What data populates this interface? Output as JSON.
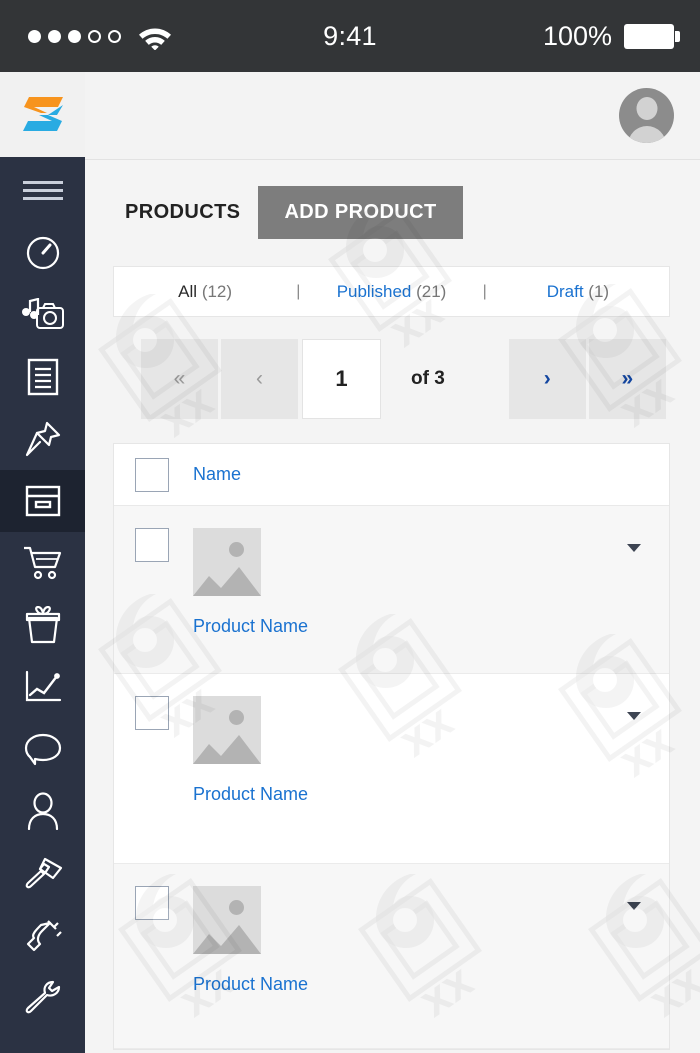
{
  "status_bar": {
    "signal_dots_filled": 3,
    "signal_dots_empty": 2,
    "wifi_icon": "wifi-icon",
    "time": "9:41",
    "battery_percent": "100%",
    "battery_icon": "battery-full-icon"
  },
  "header": {
    "logo_icon": "brand-logo-icon",
    "logo_colors": {
      "orange": "#F7941E",
      "blue": "#29ABE2"
    },
    "avatar_icon": "user-avatar-icon"
  },
  "sidebar": {
    "background": "#2b3243",
    "active_background": "#1d2330",
    "items": [
      {
        "icon": "hamburger-menu-icon",
        "label": "Menu",
        "active": false
      },
      {
        "icon": "dashboard-gauge-icon",
        "label": "Dashboard",
        "active": false
      },
      {
        "icon": "media-camera-music-icon",
        "label": "Media",
        "active": false
      },
      {
        "icon": "document-list-icon",
        "label": "Pages",
        "active": false
      },
      {
        "icon": "pushpin-icon",
        "label": "Posts",
        "active": false
      },
      {
        "icon": "archive-box-icon",
        "label": "Products",
        "active": true
      },
      {
        "icon": "shopping-cart-icon",
        "label": "Orders",
        "active": false
      },
      {
        "icon": "gift-box-icon",
        "label": "Coupons",
        "active": false
      },
      {
        "icon": "line-chart-icon",
        "label": "Analytics",
        "active": false
      },
      {
        "icon": "comment-bubble-icon",
        "label": "Comments",
        "active": false
      },
      {
        "icon": "user-profile-icon",
        "label": "Users",
        "active": false
      },
      {
        "icon": "paintbrush-icon",
        "label": "Appearance",
        "active": false
      },
      {
        "icon": "plug-icon",
        "label": "Plugins",
        "active": false
      },
      {
        "icon": "wrench-icon",
        "label": "Tools",
        "active": false
      }
    ]
  },
  "main": {
    "page_title": "PRODUCTS",
    "add_button_label": "ADD PRODUCT",
    "accent_blue": "#1a72d0",
    "filters": [
      {
        "label": "All",
        "count": "(12)",
        "current": true
      },
      {
        "label": "Published",
        "count": "(21)",
        "current": false
      },
      {
        "label": "Draft",
        "count": "(1)",
        "current": false
      }
    ],
    "filter_separator": "|",
    "pagination": {
      "first_label": "«",
      "prev_label": "‹",
      "current_page": "1",
      "total_label": "of 3",
      "next_label": "›",
      "last_label": "»"
    },
    "table": {
      "select_all_checkbox": "select-all",
      "columns": [
        "Name"
      ],
      "rows": [
        {
          "name": "Product Name",
          "thumbnail": "image-placeholder-icon",
          "checked": false
        },
        {
          "name": "Product Name",
          "thumbnail": "image-placeholder-icon",
          "checked": false
        },
        {
          "name": "Product Name",
          "thumbnail": "image-placeholder-icon",
          "checked": false
        }
      ]
    }
  }
}
